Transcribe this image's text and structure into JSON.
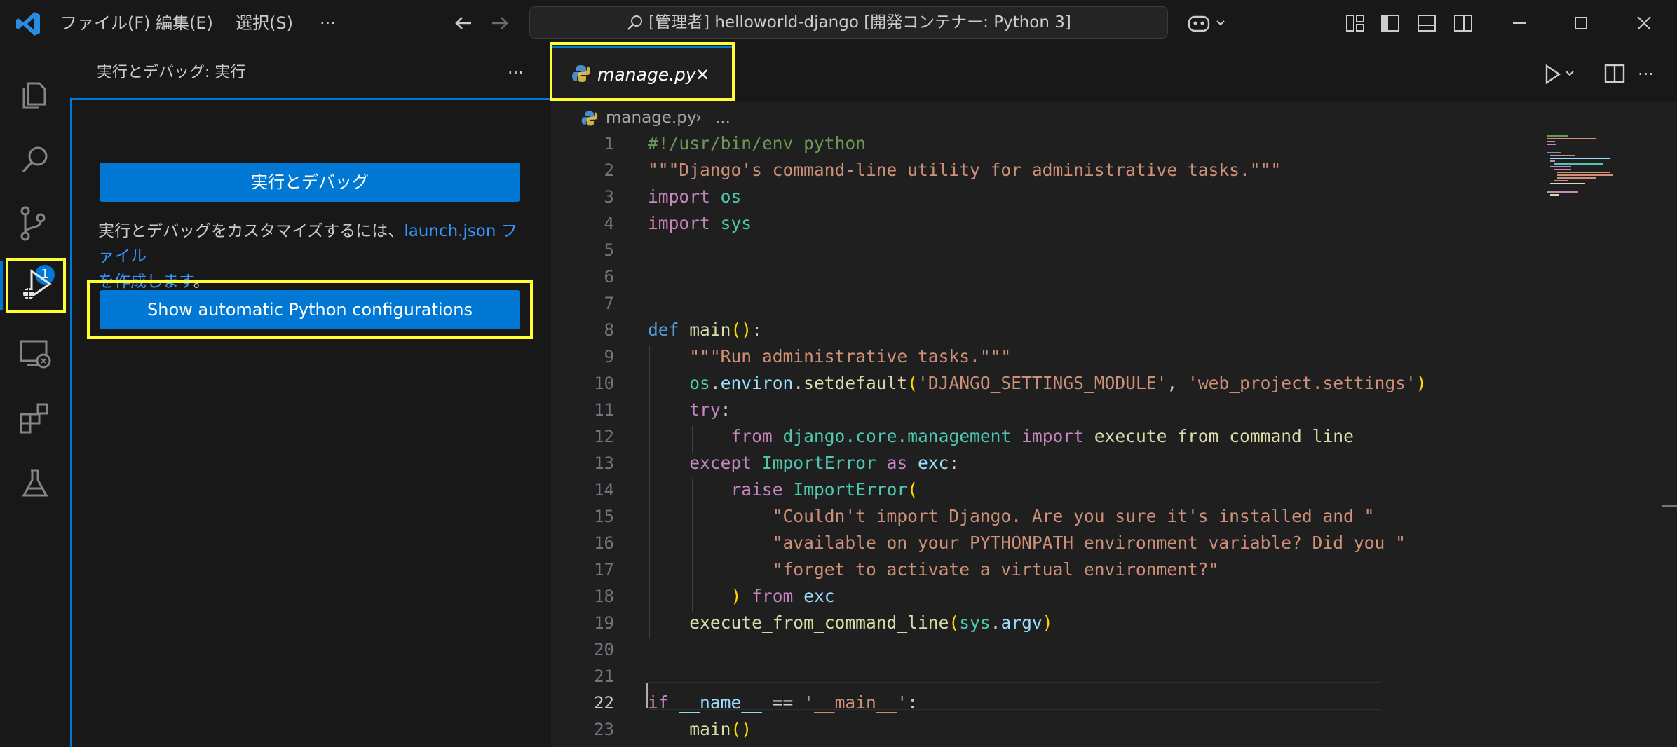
{
  "titlebar": {
    "menus": [
      "ファイル(F)",
      "編集(E)",
      "選択(S)",
      "···"
    ],
    "command_center": "[管理者] helloworld-django [開発コンテナー: Python 3]"
  },
  "activity": {
    "source_control_badge": "1"
  },
  "sidebar": {
    "title": "実行とデバッグ: 実行",
    "more": "···",
    "run_debug_button": "実行とデバッグ",
    "customize_text_1": "実行とデバッグをカスタマイズするには、",
    "customize_link_1": "launch.json ファイル",
    "customize_link_2": "を作成します",
    "customize_text_2": "。",
    "show_configs_button": "Show automatic Python configurations"
  },
  "editor": {
    "tab_label": "manage.py",
    "tab_close": "✕",
    "breadcrumb_file": "manage.py",
    "breadcrumb_sep": "›",
    "breadcrumb_more": "...",
    "more": "···",
    "current_line": 22,
    "line_numbers": [
      "1",
      "2",
      "3",
      "4",
      "5",
      "6",
      "7",
      "8",
      "9",
      "10",
      "11",
      "12",
      "13",
      "14",
      "15",
      "16",
      "17",
      "18",
      "19",
      "20",
      "21",
      "22",
      "23"
    ],
    "code_lines": [
      "#!/usr/bin/env python",
      "\"\"\"Django's command-line utility for administrative tasks.\"\"\"",
      "import os",
      "import sys",
      "",
      "",
      "def main():",
      "    \"\"\"Run administrative tasks.\"\"\"",
      "    os.environ.setdefault('DJANGO_SETTINGS_MODULE', 'web_project.settings')",
      "    try:",
      "        from django.core.management import execute_from_command_line",
      "    except ImportError as exc:",
      "        raise ImportError(",
      "            \"Couldn't import Django. Are you sure it's installed and \"",
      "            \"available on your PYTHONPATH environment variable? Did you \"",
      "            \"forget to activate a virtual environment?\"",
      "        ) from exc",
      "    execute_from_command_line(sys.argv)",
      "",
      "",
      "if __name__ == '__main__':",
      "    main()",
      ""
    ]
  },
  "colors": {
    "accent": "#0078d4",
    "highlight": "#ffff33"
  }
}
